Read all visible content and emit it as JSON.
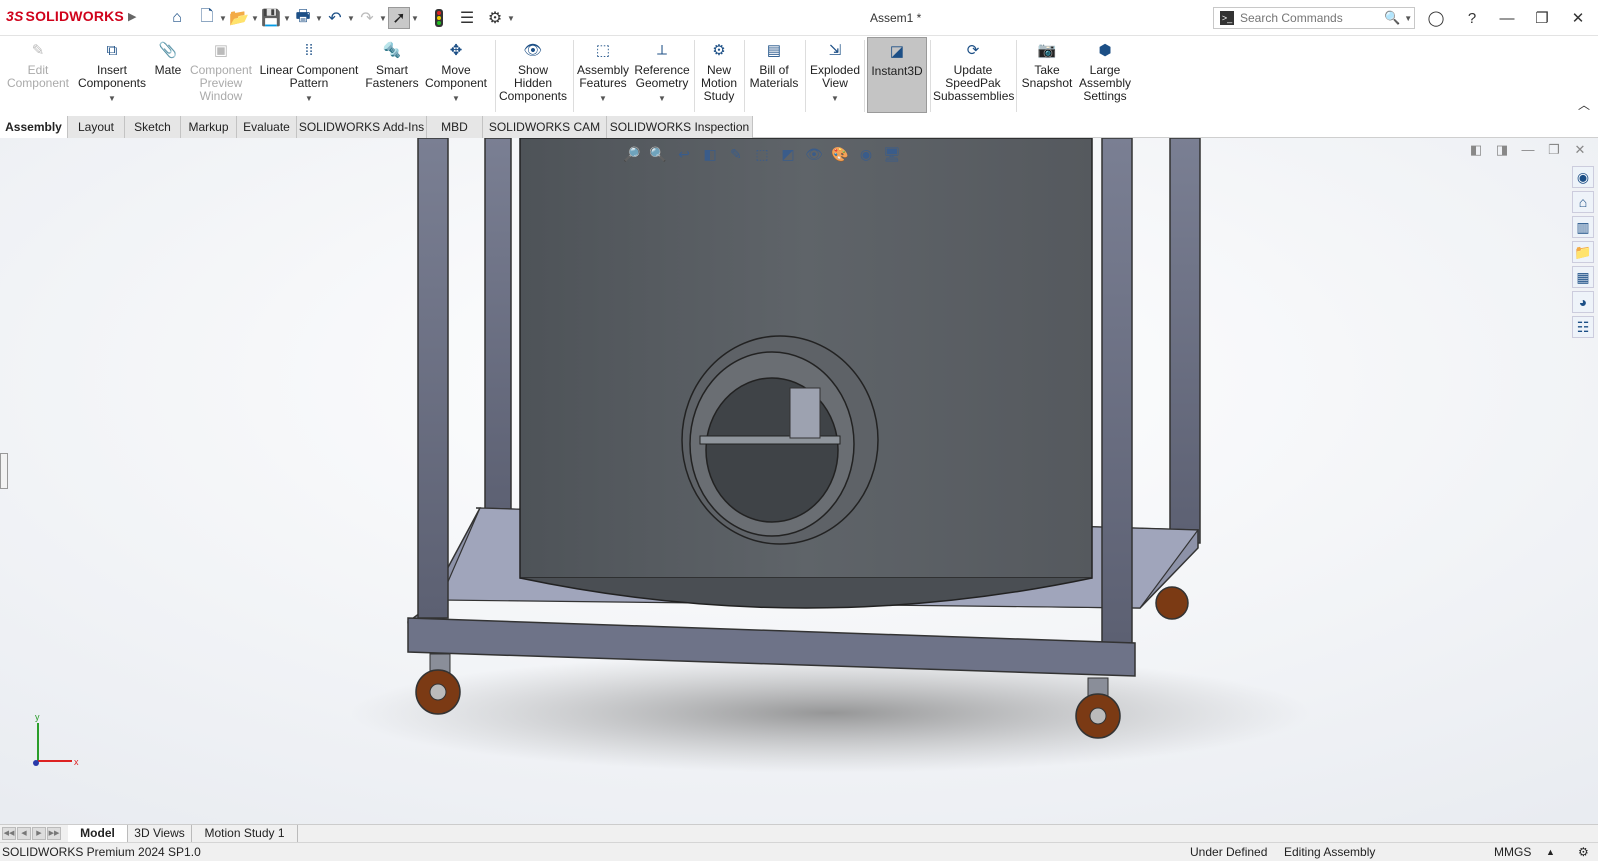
{
  "app": {
    "logo": "SOLIDWORKS",
    "logo_prefix": "3S",
    "document_title": "Assem1 *"
  },
  "search": {
    "placeholder": "Search Commands"
  },
  "quick_access": [
    "home-icon",
    "new-document-icon",
    "open-icon",
    "save-icon",
    "print-icon",
    "undo-icon",
    "redo-icon",
    "select-icon",
    "rebuild-icon",
    "file-properties-icon",
    "options-icon"
  ],
  "ribbon": {
    "edit_component": "Edit Component",
    "insert_components": "Insert Components",
    "mate": "Mate",
    "component_preview": "Component Preview Window",
    "linear_pattern": "Linear Component Pattern",
    "smart_fasteners": "Smart Fasteners",
    "move_component": "Move Component",
    "show_hidden": "Show Hidden Components",
    "assembly_features": "Assembly Features",
    "reference_geometry": "Reference Geometry",
    "new_motion_study": "New Motion Study",
    "bill_of_materials": "Bill of Materials",
    "exploded_view": "Exploded View",
    "instant3d": "Instant3D",
    "update_speedpak": "Update SpeedPak Subassemblies",
    "take_snapshot": "Take Snapshot",
    "large_assembly": "Large Assembly Settings"
  },
  "tabs": [
    "Assembly",
    "Layout",
    "Sketch",
    "Markup",
    "Evaluate",
    "SOLIDWORKS Add-Ins",
    "MBD",
    "SOLIDWORKS CAM",
    "SOLIDWORKS Inspection"
  ],
  "bottom_tabs": [
    "Model",
    "3D Views",
    "Motion Study 1"
  ],
  "status": {
    "product": "SOLIDWORKS Premium 2024 SP1.0",
    "state": "Under Defined",
    "mode": "Editing Assembly",
    "units": "MMGS"
  },
  "triad": {
    "x": "x",
    "y": "y"
  }
}
